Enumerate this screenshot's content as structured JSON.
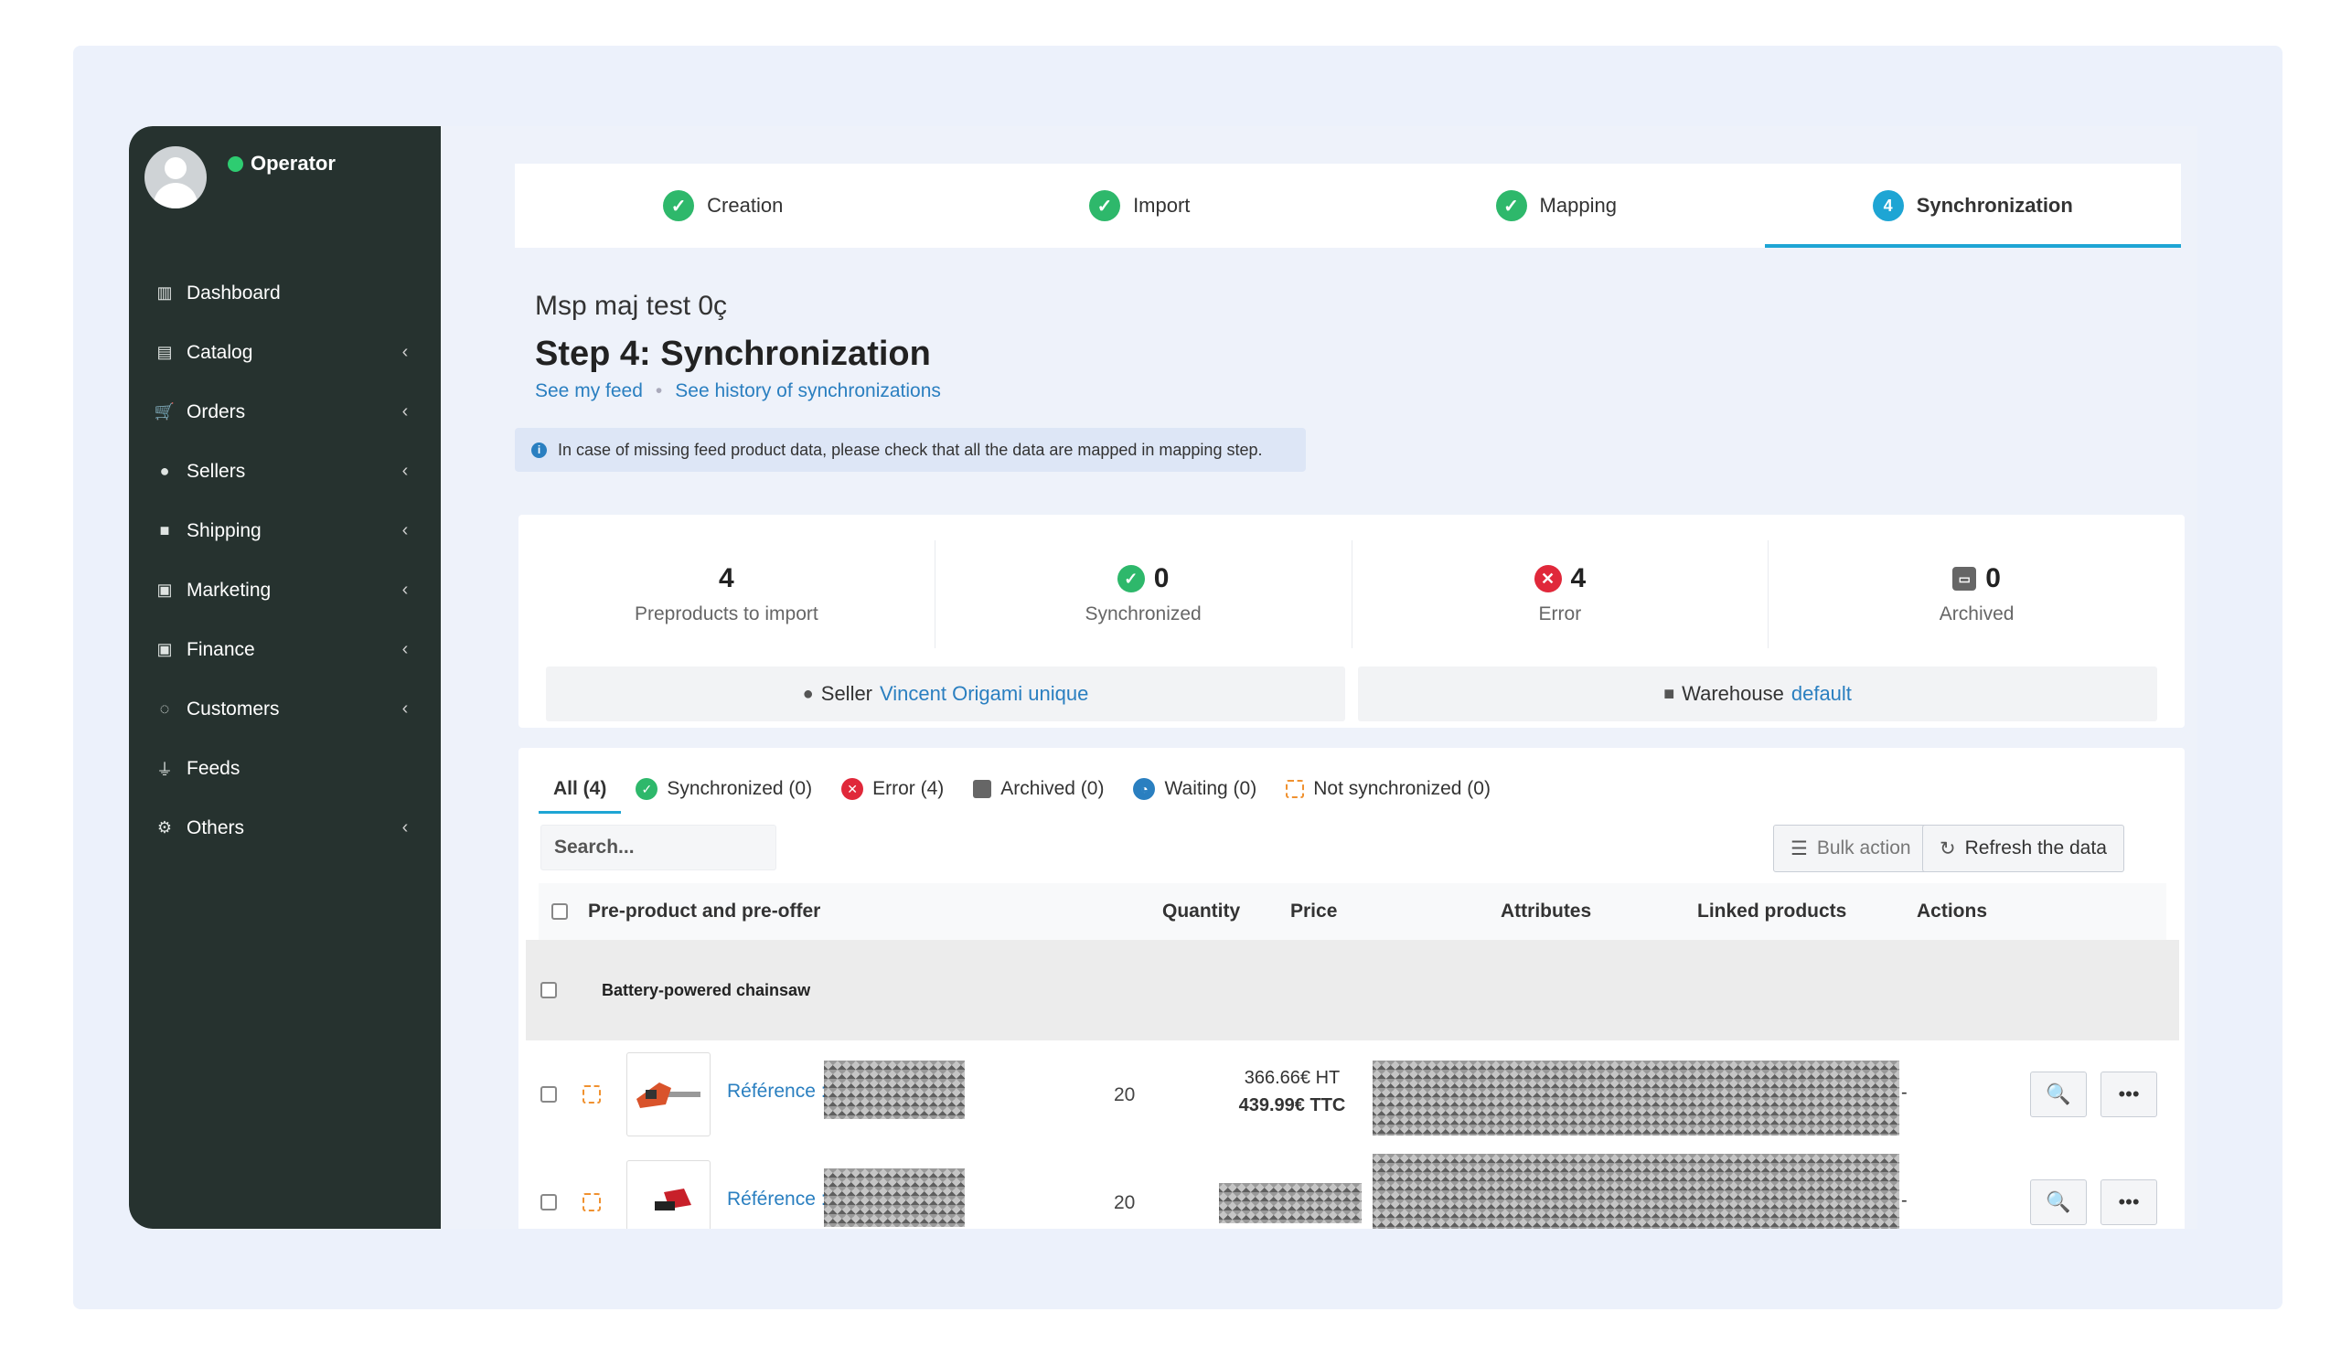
{
  "sidebar": {
    "user_status": "Operator",
    "items": [
      {
        "label": "Dashboard",
        "icon": "chart-icon",
        "has_chevron": false
      },
      {
        "label": "Catalog",
        "icon": "book-icon",
        "has_chevron": true
      },
      {
        "label": "Orders",
        "icon": "cart-icon",
        "has_chevron": true
      },
      {
        "label": "Sellers",
        "icon": "user-circle-icon",
        "has_chevron": true
      },
      {
        "label": "Shipping",
        "icon": "truck-icon",
        "has_chevron": true
      },
      {
        "label": "Marketing",
        "icon": "money-icon",
        "has_chevron": true
      },
      {
        "label": "Finance",
        "icon": "money-icon",
        "has_chevron": true
      },
      {
        "label": "Customers",
        "icon": "chat-icon",
        "has_chevron": true
      },
      {
        "label": "Feeds",
        "icon": "plug-icon",
        "has_chevron": false
      },
      {
        "label": "Others",
        "icon": "gears-icon",
        "has_chevron": true
      }
    ]
  },
  "steps": [
    {
      "label": "Creation",
      "state": "done"
    },
    {
      "label": "Import",
      "state": "done"
    },
    {
      "label": "Mapping",
      "state": "done"
    },
    {
      "label": "Synchronization",
      "state": "active",
      "number": "4"
    }
  ],
  "page": {
    "feed_name": "Msp maj test 0ç",
    "title": "Step 4: Synchronization",
    "link_feed": "See my feed",
    "link_history": "See history of synchronizations",
    "info": "In case of missing feed product data, please check that all the data are mapped in mapping step."
  },
  "stats": [
    {
      "value": "4",
      "label": "Preproducts to import",
      "icon": ""
    },
    {
      "value": "0",
      "label": "Synchronized",
      "icon": "check-icon"
    },
    {
      "value": "4",
      "label": "Error",
      "icon": "error-icon"
    },
    {
      "value": "0",
      "label": "Archived",
      "icon": "archive-icon"
    }
  ],
  "seller": {
    "label": "Seller",
    "value": "Vincent Origami unique"
  },
  "warehouse": {
    "label": "Warehouse",
    "value": "default"
  },
  "tabs": [
    {
      "label": "All (4)"
    },
    {
      "label": "Synchronized (0)"
    },
    {
      "label": "Error (4)"
    },
    {
      "label": "Archived (0)"
    },
    {
      "label": "Waiting (0)"
    },
    {
      "label": "Not synchronized (0)"
    }
  ],
  "search": {
    "placeholder": "Search..."
  },
  "buttons": {
    "bulk": "Bulk action",
    "refresh": "Refresh the data"
  },
  "columns": {
    "product": "Pre-product and pre-offer",
    "quantity": "Quantity",
    "price": "Price",
    "attributes": "Attributes",
    "linked": "Linked products",
    "actions": "Actions"
  },
  "group": {
    "title": "Battery-powered chainsaw"
  },
  "rows": [
    {
      "ref_label": "Référence :",
      "quantity": "20",
      "price_ht": "366.66€ HT",
      "price_ttc": "439.99€ TTC",
      "dash": "-"
    },
    {
      "ref_label": "Référence :",
      "quantity": "20",
      "price_ht": "",
      "price_ttc": "",
      "dash": "-"
    }
  ],
  "colors": {
    "accent": "#1ea5d4",
    "success": "#2eb86b",
    "error": "#e0283a",
    "link": "#2a7fc0",
    "sidebar": "#26322f"
  }
}
